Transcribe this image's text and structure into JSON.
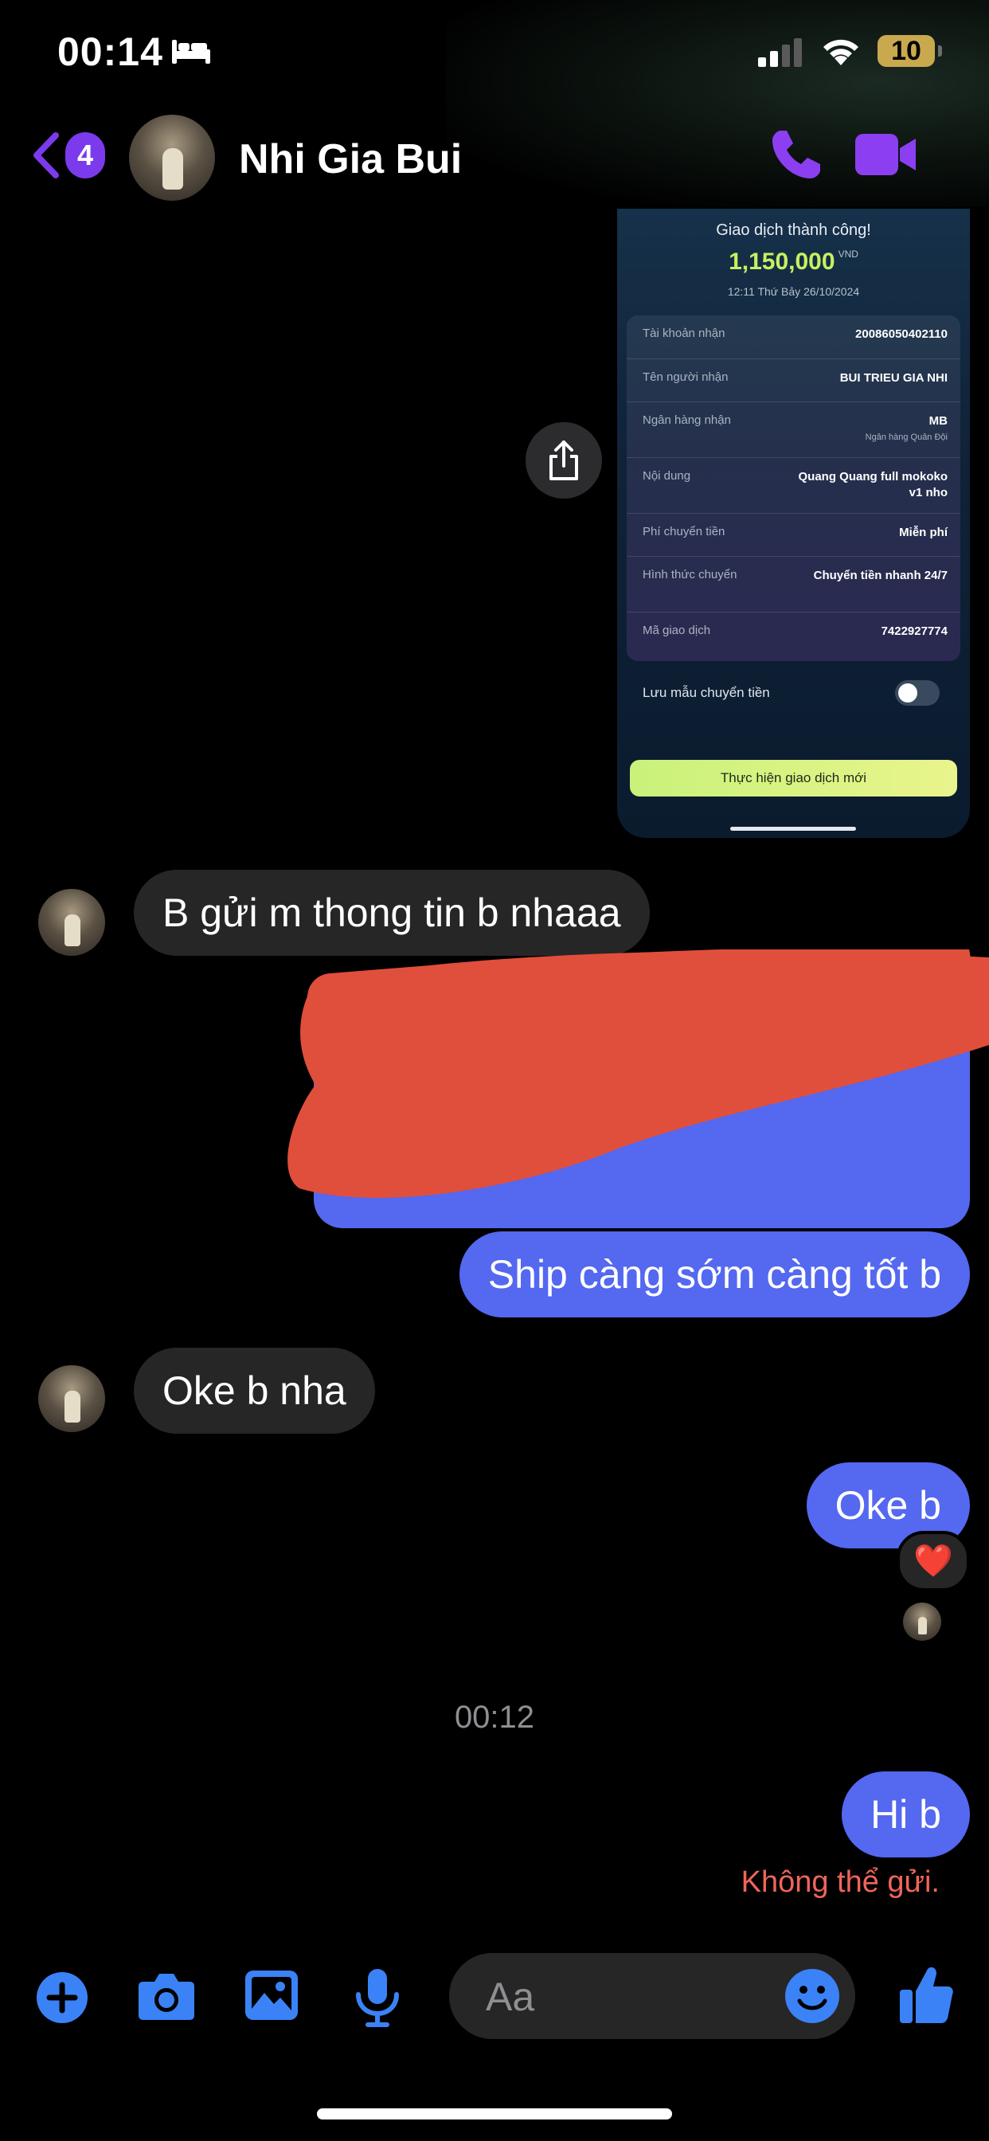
{
  "status_bar": {
    "time": "00:14",
    "battery": "10"
  },
  "header": {
    "unread_count": "4",
    "contact_name": "Nhi Gia Bui"
  },
  "receipt": {
    "title": "Giao dịch thành công!",
    "amount": "1,150,000",
    "currency": "VND",
    "datetime": "12:11 Thứ Bảy 26/10/2024",
    "rows": [
      {
        "label": "Tài khoản nhận",
        "value": "20086050402110"
      },
      {
        "label": "Tên người nhận",
        "value": "BUI TRIEU GIA NHI"
      },
      {
        "label": "Ngân hàng nhận",
        "value": "MB",
        "sub": "Ngân hàng Quân Đội"
      },
      {
        "label": "Nội dung",
        "value": "Quang Quang full mokoko v1 nho"
      },
      {
        "label": "Phí chuyển tiền",
        "value": "Miễn phí"
      },
      {
        "label": "Hình thức chuyển",
        "value": "Chuyển tiền nhanh 24/7"
      },
      {
        "label": "Mã giao dịch",
        "value": "7422927774"
      }
    ],
    "save_template_label": "Lưu mẫu chuyển tiền",
    "new_transaction_button": "Thực hiện giao dịch mới"
  },
  "messages": {
    "incoming_1": "B gửi m thong tin b nhaaa",
    "outgoing_1": "Ship càng sớm càng tốt b",
    "incoming_2": "Oke b nha",
    "outgoing_2": "Oke b",
    "reaction": "❤️",
    "timestamp": "00:12",
    "outgoing_3": "Hi b",
    "error": "Không thể gửi."
  },
  "composer": {
    "placeholder": "Aa"
  },
  "colors": {
    "accent_purple": "#7c3aed",
    "outgoing_bubble": "#5468f0",
    "incoming_bubble": "#262626",
    "composer_icons": "#3b82f6",
    "error_red": "#f0655b",
    "redaction_red": "#e04f3c"
  }
}
